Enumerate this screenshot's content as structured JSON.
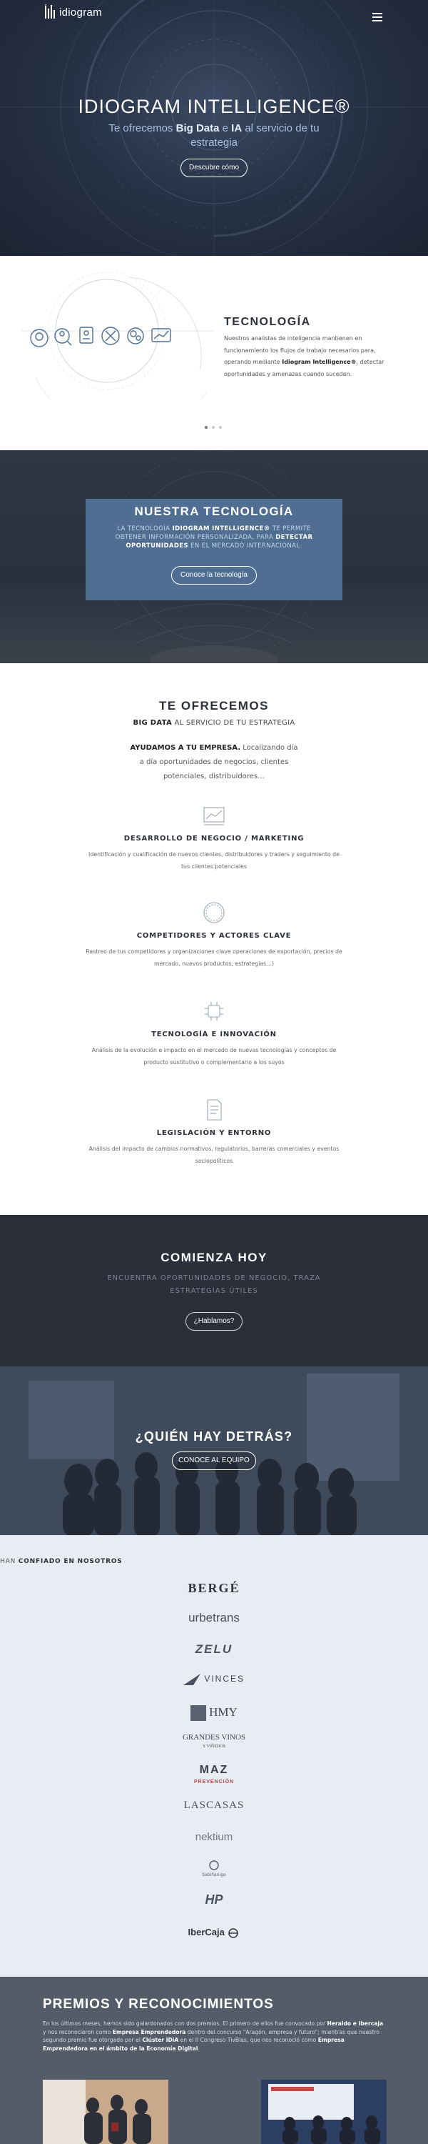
{
  "header": {
    "logo_text": "idiogram",
    "menu_icon": "hamburger-menu-icon"
  },
  "hero": {
    "title": "IDIOGRAM INTELLIGENCE®",
    "subtitle_pre": "Te ofrecemos ",
    "subtitle_bold1": "Big Data",
    "subtitle_mid": " e ",
    "subtitle_bold2": "IA",
    "subtitle_post": " al servicio de tu estrategia",
    "button": "Descubre cómo"
  },
  "tecnologia": {
    "title": "TECNOLOGÍA",
    "text_pre": "Nuestros analistas de inteligencia mantienen en funcionamiento los flujos de trabajo necesarios para, operando mediante ",
    "text_bold": "Idiogram Intelligence®",
    "text_post": ", detectar oportunidades y amenazas cuando suceden.",
    "icons": [
      "target-head-icon",
      "magnifier-person-icon",
      "document-id-icon",
      "tools-icon",
      "gears-head-icon",
      "chart-icon"
    ],
    "slider_dots": 3,
    "active_dot": 0
  },
  "nuestra_tecnologia": {
    "title": "NUESTRA TECNOLOGÍA",
    "text_1": "LA TECNOLOGÍA ",
    "text_bold1": "IDIOGRAM INTELLIGENCE®",
    "text_2": " TE PERMITE OBTENER INFORMACIÓN PERSONALIZADA, PARA ",
    "text_bold2": "DETECTAR OPORTUNIDADES",
    "text_3": " EN EL MERCADO INTERNACIONAL.",
    "button": "Conoce la tecnología"
  },
  "ofrecemos": {
    "title": "TE OFRECEMOS",
    "sub_bold": "BIG DATA",
    "sub_rest": " AL SERVICIO DE TU ESTRATEGIA",
    "intro_bold": "AYUDAMOS A TU EMPRESA.",
    "intro_rest": " Localizando día a día oportunidades de negocios, clientes potenciales, distribuidores…",
    "services": [
      {
        "title": "DESARROLLO DE NEGOCIO / MARKETING",
        "desc": "Identificación y cualificación de nuevos clientes, distribuidores y traders y seguimiento de tus clientes potenciales",
        "icon": "line-chart-icon"
      },
      {
        "title": "COMPETIDORES Y ACTORES CLAVE",
        "desc": "Rastreo de tus competidores y organizaciones clave operaciones de exportación, precios de mercado, nuevos productos, estrategias…)",
        "icon": "circle-icon"
      },
      {
        "title": "TECNOLOGÍA E INNOVACIÓN",
        "desc": "Análisis de la evolución e impacto en el mercado de nuevas tecnologías y conceptos de producto sustitutivo o complementario a los suyos",
        "icon": "chip-icon"
      },
      {
        "title": "LEGISLACIÓN Y ENTORNO",
        "desc": "Análisis del impacto de cambios normativos, regulatorios, barreras comerciales y eventos sociopolíticos",
        "icon": "document-icon"
      }
    ]
  },
  "comienza": {
    "title": "COMIENZA HOY",
    "subtitle": "ENCUENTRA OPORTUNIDADES DE NEGOCIO, TRAZA ESTRATEGIAS ÚTILES",
    "button": "¿Hablamos?"
  },
  "quien": {
    "title": "¿QUIÉN HAY DETRÁS?",
    "button": "CONOCE AL EQUIPO"
  },
  "clientes": {
    "title_pre": "HAN ",
    "title_bold": "CONFIADO EN NOSOTROS",
    "logos": [
      "BERGÉ",
      "urbetrans",
      "ZELU",
      "VINCES",
      "HMY",
      "GRANDES VINOS",
      "MAZ",
      "LASCASAS",
      "nektium",
      "Sabiñanigo",
      "HP",
      "IberCaja"
    ],
    "logo_captions": {
      "grandes_vinos_sub": "Y VIÑEDOS",
      "maz_sub": "PREVENCIÓN"
    }
  },
  "premios": {
    "title": "PREMIOS Y RECONOCIMIENTOS",
    "text_1": "En los últimos meses, hemos sido galardonados con dos premios. El primero de ellos fue convocado por ",
    "text_b1": "Heraldo e Ibercaja",
    "text_2": " y nos reconocieron como ",
    "text_b2": "Empresa Emprendedora",
    "text_3": " dentro del concurso \"Aragón, empresa y futuro\"; mientras que nuestro segundo premio fue otorgado por el ",
    "text_b3": "Clúster IDiA",
    "text_4": " en el II Congreso TivBlas, que nos reconoció como ",
    "text_b4": "Empresa Emprendedora en el ámbito de la Economía Digital",
    "text_5": "."
  }
}
